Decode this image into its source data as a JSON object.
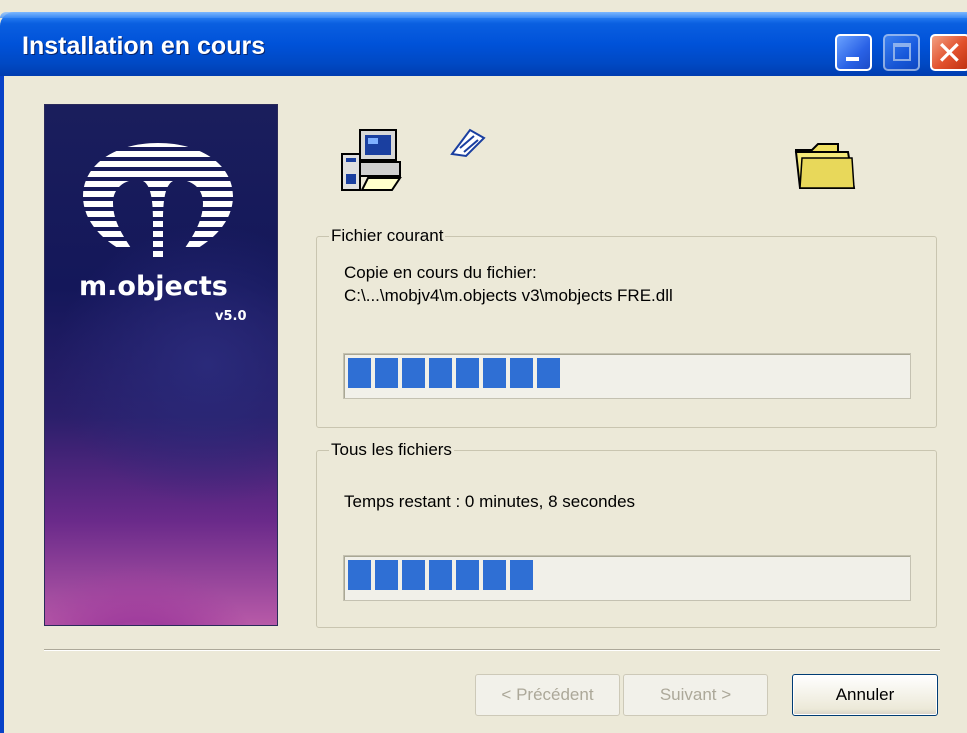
{
  "window": {
    "title": "Installation en cours",
    "controls": [
      "minimize-icon",
      "maximize-icon",
      "close-icon"
    ]
  },
  "banner": {
    "product": "m.objects",
    "version": "v5.0"
  },
  "current_file": {
    "group_title": "Fichier courant",
    "status_line": "Copie en cours du fichier:",
    "file_path": "C:\\...\\mobjv4\\m.objects v3\\mobjects FRE.dll",
    "progress_fraction": 0.38
  },
  "all_files": {
    "group_title": "Tous les fichiers",
    "time_remaining": "Temps restant : 0 minutes, 8 secondes",
    "progress_fraction": 0.33
  },
  "buttons": {
    "back": "< Précédent",
    "next": "Suivant >",
    "cancel": "Annuler"
  },
  "colors": {
    "title_bar": "#0052d9",
    "progress_fill": "#2f6fd4",
    "dialog_bg": "#ece9d8"
  }
}
